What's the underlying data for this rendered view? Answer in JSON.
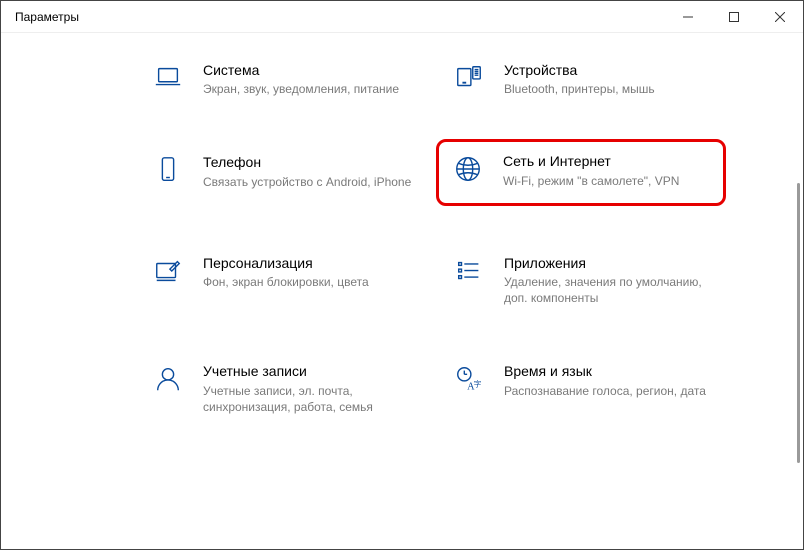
{
  "window": {
    "title": "Параметры"
  },
  "tiles": {
    "system": {
      "title": "Система",
      "desc": "Экран, звук, уведомления, питание"
    },
    "devices": {
      "title": "Устройства",
      "desc": "Bluetooth, принтеры, мышь"
    },
    "phone": {
      "title": "Телефон",
      "desc": "Связать устройство с Android, iPhone"
    },
    "network": {
      "title": "Сеть и Интернет",
      "desc": "Wi-Fi, режим \"в самолете\", VPN"
    },
    "personalization": {
      "title": "Персонализация",
      "desc": "Фон, экран блокировки, цвета"
    },
    "apps": {
      "title": "Приложения",
      "desc": "Удаление, значения по умолчанию, доп. компоненты"
    },
    "accounts": {
      "title": "Учетные записи",
      "desc": "Учетные записи, эл. почта, синхронизация, работа, семья"
    },
    "time": {
      "title": "Время и язык",
      "desc": "Распознавание голоса, регион, дата"
    }
  }
}
